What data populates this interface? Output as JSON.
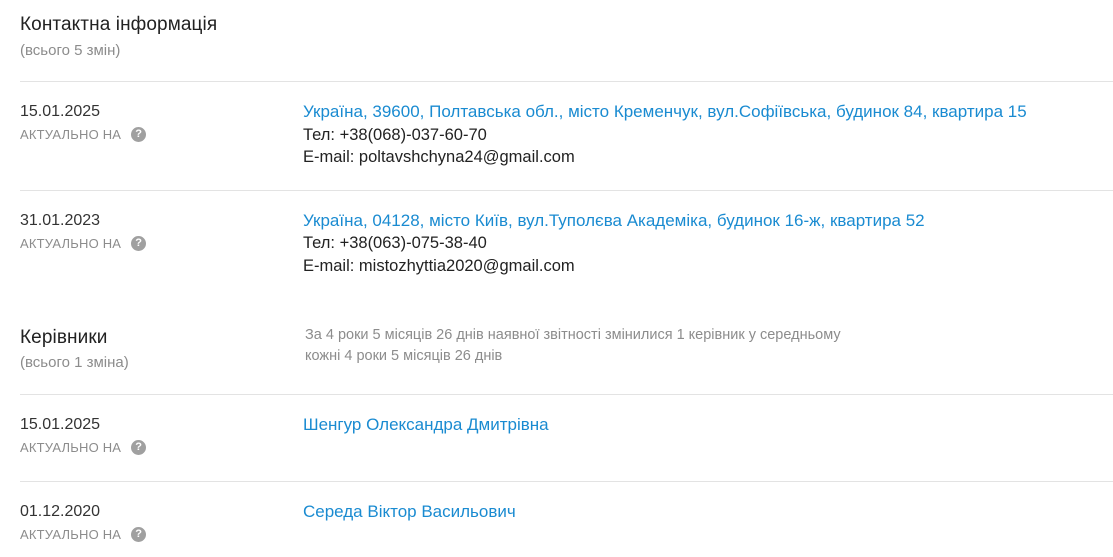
{
  "contacts": {
    "title": "Контактна інформація",
    "subtitle": "(всього 5 змін)",
    "entries": [
      {
        "date": "15.01.2025",
        "actual_label": "АКТУАЛЬНО НА",
        "address": "Україна, 39600, Полтавська обл., місто Кременчук, вул.Софіївська, будинок 84, квартира 15",
        "phone": "Тел: +38(068)-037-60-70",
        "email": "E-mail: poltavshchyna24@gmail.com"
      },
      {
        "date": "31.01.2023",
        "actual_label": "АКТУАЛЬНО НА",
        "address": "Україна, 04128, місто Київ, вул.Туполєва Академіка, будинок 16-ж, квартира 52",
        "phone": "Тел: +38(063)-075-38-40",
        "email": "E-mail: mistozhyttia2020@gmail.com"
      }
    ]
  },
  "managers": {
    "title": "Керівники",
    "subtitle": "(всього 1 зміна)",
    "note": "За 4 роки 5 місяців 26 днів наявної звітності змінилися 1 керівник у середньому кожні 4 роки 5 місяців 26 днів",
    "entries": [
      {
        "date": "15.01.2025",
        "actual_label": "АКТУАЛЬНО НА",
        "name": "Шенгур Олександра Дмитрівна"
      },
      {
        "date": "01.12.2020",
        "actual_label": "АКТУАЛЬНО НА",
        "name": "Середа Віктор Васильович"
      }
    ]
  },
  "icons": {
    "help": "question-circle-icon",
    "help_glyph": "?"
  },
  "colors": {
    "link": "#1a8bd1",
    "muted": "#8c8c8c",
    "text": "#222222",
    "divider": "#e3e3e3"
  }
}
